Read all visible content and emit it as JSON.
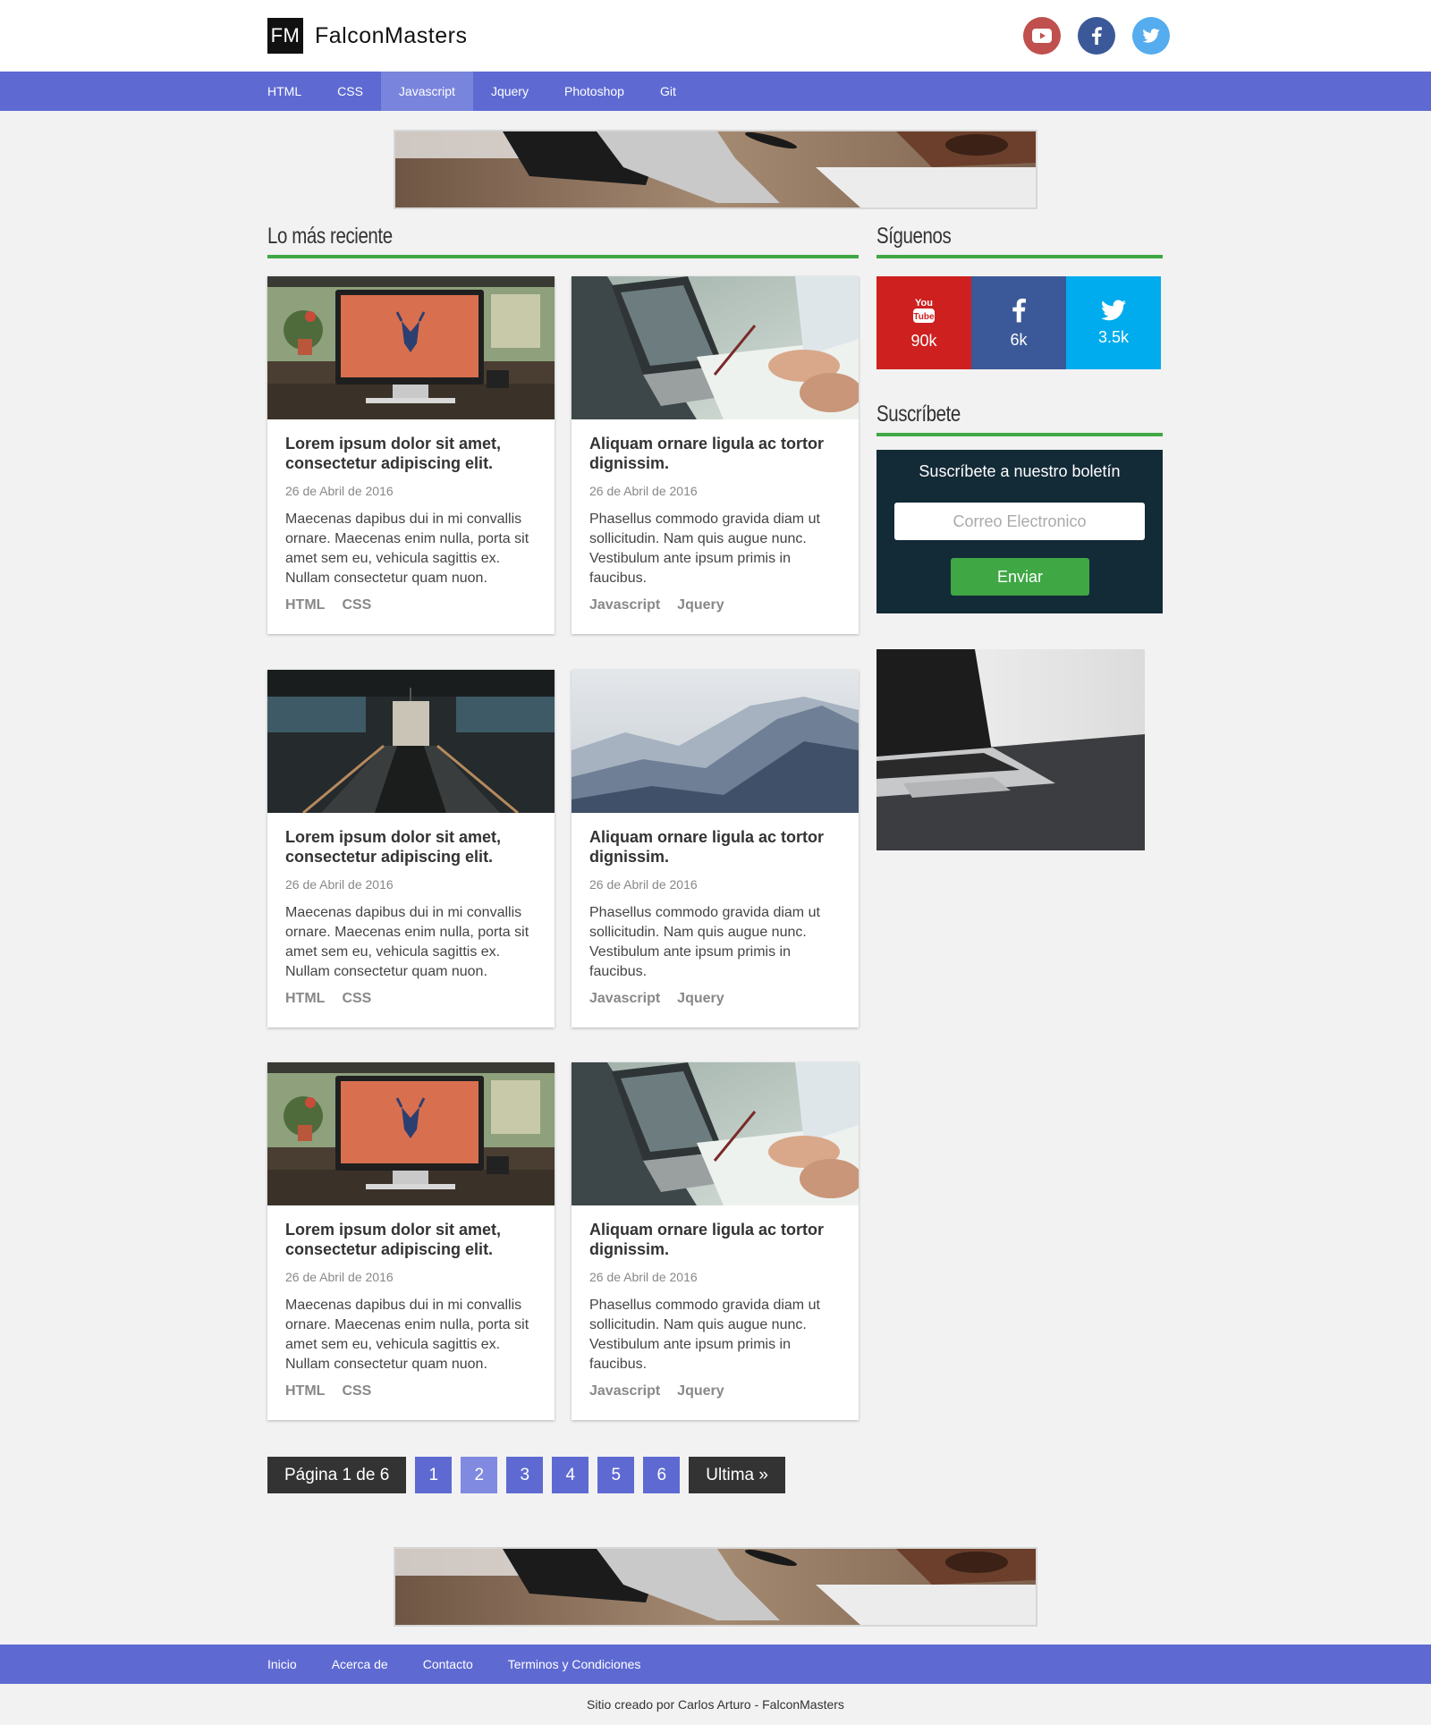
{
  "header": {
    "logo_mark": "FM",
    "brand_name": "FalconMasters",
    "social_icons": [
      "youtube-icon",
      "facebook-icon",
      "twitter-icon"
    ],
    "colors": {
      "youtube": "#c0504d",
      "facebook": "#3b5998",
      "twitter": "#55acee"
    }
  },
  "nav": {
    "items": [
      {
        "label": "HTML"
      },
      {
        "label": "CSS"
      },
      {
        "label": "Javascript",
        "active": true
      },
      {
        "label": "Jquery"
      },
      {
        "label": "Photoshop"
      },
      {
        "label": "Git"
      }
    ]
  },
  "main": {
    "section_title": "Lo más reciente",
    "posts": [
      {
        "title": "Lorem ipsum dolor sit amet, consectetur adipiscing elit.",
        "date": "26 de Abril de 2016",
        "excerpt": "Maecenas dapibus dui in mi convallis ornare. Maecenas enim nulla, porta sit amet sem eu, vehicula sagittis ex. Nullam consectetur quam nuon.",
        "tags": [
          "HTML",
          "CSS"
        ],
        "image": "desk-imac"
      },
      {
        "title": "Aliquam ornare ligula ac tortor dignissim.",
        "date": "26 de Abril de 2016",
        "excerpt": "Phasellus commodo gravida diam ut sollicitudin. Nam quis augue nunc. Vestibulum ante ipsum primis in faucibus.",
        "tags": [
          "Javascript",
          "Jquery"
        ],
        "image": "laptop-writing"
      },
      {
        "title": "Lorem ipsum dolor sit amet, consectetur adipiscing elit.",
        "date": "26 de Abril de 2016",
        "excerpt": "Maecenas dapibus dui in mi convallis ornare. Maecenas enim nulla, porta sit amet sem eu, vehicula sagittis ex. Nullam consectetur quam nuon.",
        "tags": [
          "HTML",
          "CSS"
        ],
        "image": "escalator"
      },
      {
        "title": "Aliquam ornare ligula ac tortor dignissim.",
        "date": "26 de Abril de 2016",
        "excerpt": "Phasellus commodo gravida diam ut sollicitudin. Nam quis augue nunc. Vestibulum ante ipsum primis in faucibus.",
        "tags": [
          "Javascript",
          "Jquery"
        ],
        "image": "mountains"
      },
      {
        "title": "Lorem ipsum dolor sit amet, consectetur adipiscing elit.",
        "date": "26 de Abril de 2016",
        "excerpt": "Maecenas dapibus dui in mi convallis ornare. Maecenas enim nulla, porta sit amet sem eu, vehicula sagittis ex. Nullam consectetur quam nuon.",
        "tags": [
          "HTML",
          "CSS"
        ],
        "image": "desk-imac"
      },
      {
        "title": "Aliquam ornare ligula ac tortor dignissim.",
        "date": "26 de Abril de 2016",
        "excerpt": "Phasellus commodo gravida diam ut sollicitudin. Nam quis augue nunc. Vestibulum ante ipsum primis in faucibus.",
        "tags": [
          "Javascript",
          "Jquery"
        ],
        "image": "laptop-writing"
      }
    ]
  },
  "pagination": {
    "info": "Página 1 de 6",
    "pages": [
      "1",
      "2",
      "3",
      "4",
      "5",
      "6"
    ],
    "current": "2",
    "last_label": "Ultima »"
  },
  "sidebar": {
    "follow_title": "Síguenos",
    "follow": [
      {
        "network": "youtube",
        "icon": "youtube-icon",
        "count": "90k",
        "color": "#cd201f"
      },
      {
        "network": "facebook",
        "icon": "facebook-icon",
        "count": "6k",
        "color": "#3b5998"
      },
      {
        "network": "twitter",
        "icon": "twitter-icon",
        "count": "3.5k",
        "color": "#00aced"
      }
    ],
    "subscribe_title": "Suscríbete",
    "subscribe_text": "Suscríbete a nuestro boletín",
    "email_placeholder": "Correo Electronico",
    "submit_label": "Enviar"
  },
  "footer": {
    "links": [
      "Inicio",
      "Acerca de",
      "Contacto",
      "Terminos y Condiciones"
    ],
    "credits": "Sitio creado por Carlos Arturo - FalconMasters"
  },
  "colors": {
    "primary": "#5e6ad2",
    "accent": "#3fa744",
    "dark": "#333333",
    "subscribe_bg": "#132a37"
  }
}
